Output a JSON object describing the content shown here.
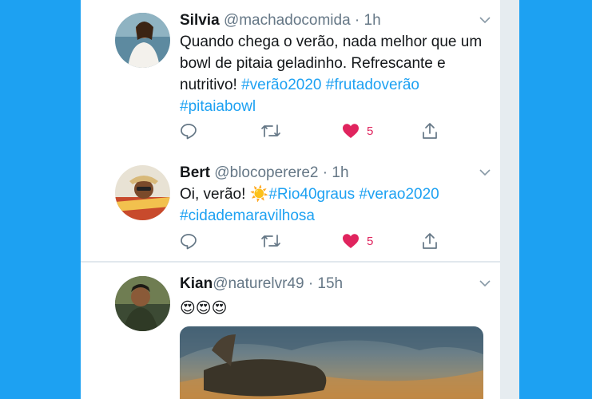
{
  "tweets": [
    {
      "name": "Silvia",
      "handle": "@machadocomida",
      "time": "1h",
      "text": "Quando chega o verão, nada melhor que um bowl de pitaia geladinho. Refrescante e nutritivo! ",
      "hashtags": [
        "#verão2020",
        "#frutadoverão",
        "#pitaiabowl"
      ],
      "likes": "5"
    },
    {
      "name": "Bert",
      "handle": "@blocoperere2",
      "time": "1h",
      "text_prefix": "Oi, verão! ",
      "emoji": "☀️",
      "hashtags": [
        "#Rio40graus",
        "#verao2020",
        "#cidademaravilhosa"
      ],
      "likes": "5"
    },
    {
      "name": "Kian",
      "handle": "@naturelvr49",
      "time": "15h",
      "emojis": "😍😍😍"
    }
  ],
  "icons": {
    "reply": "reply-icon",
    "retweet": "retweet-icon",
    "like": "heart-icon",
    "share": "share-icon",
    "menu": "chevron-down-icon"
  },
  "colors": {
    "background": "#1da1f2",
    "hashtag": "#1da1f2",
    "like": "#e0245e",
    "icon": "#657786"
  }
}
